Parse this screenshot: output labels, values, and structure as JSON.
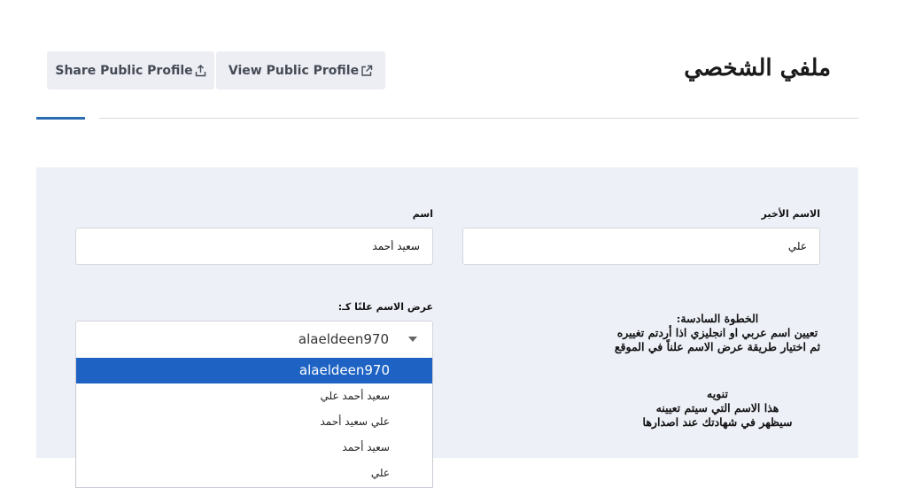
{
  "header": {
    "title": "ملفي الشخصي",
    "share_label": "Share Public Profile",
    "view_label": "View Public Profile"
  },
  "form": {
    "lastname_label": "الاسم الأخير",
    "lastname_value": "علي",
    "name_label": "اسم",
    "name_value": "سعيد أحمد",
    "display_label": "عرض الاسم علنًا كـ:",
    "display_value": "alaeldeen970",
    "display_options": [
      "alaeldeen970",
      "سعيد أحمد علي",
      "علي سعيد أحمد",
      "سعيد أحمد",
      "علي"
    ]
  },
  "info": {
    "step_title": "الخطوة السادسة:",
    "step_line1": "تعيين اسم عربي او انجليزي اذا أردتم تغييره",
    "step_line2": "ثم اختيار طريقة عرض الاسم علناً في الموقع",
    "note_title": "تنويه",
    "note_line1": "هذا الاسم التي سيتم تعيينه",
    "note_line2": "سيظهر في شهادتك عند اصدارها"
  },
  "colors": {
    "accent": "#1e63c4",
    "panel_bg": "#eef0f8",
    "button_bg": "#eceef4"
  },
  "icons": {
    "share": "share-upload-icon",
    "external": "external-link-icon",
    "caret": "caret-down-icon"
  }
}
